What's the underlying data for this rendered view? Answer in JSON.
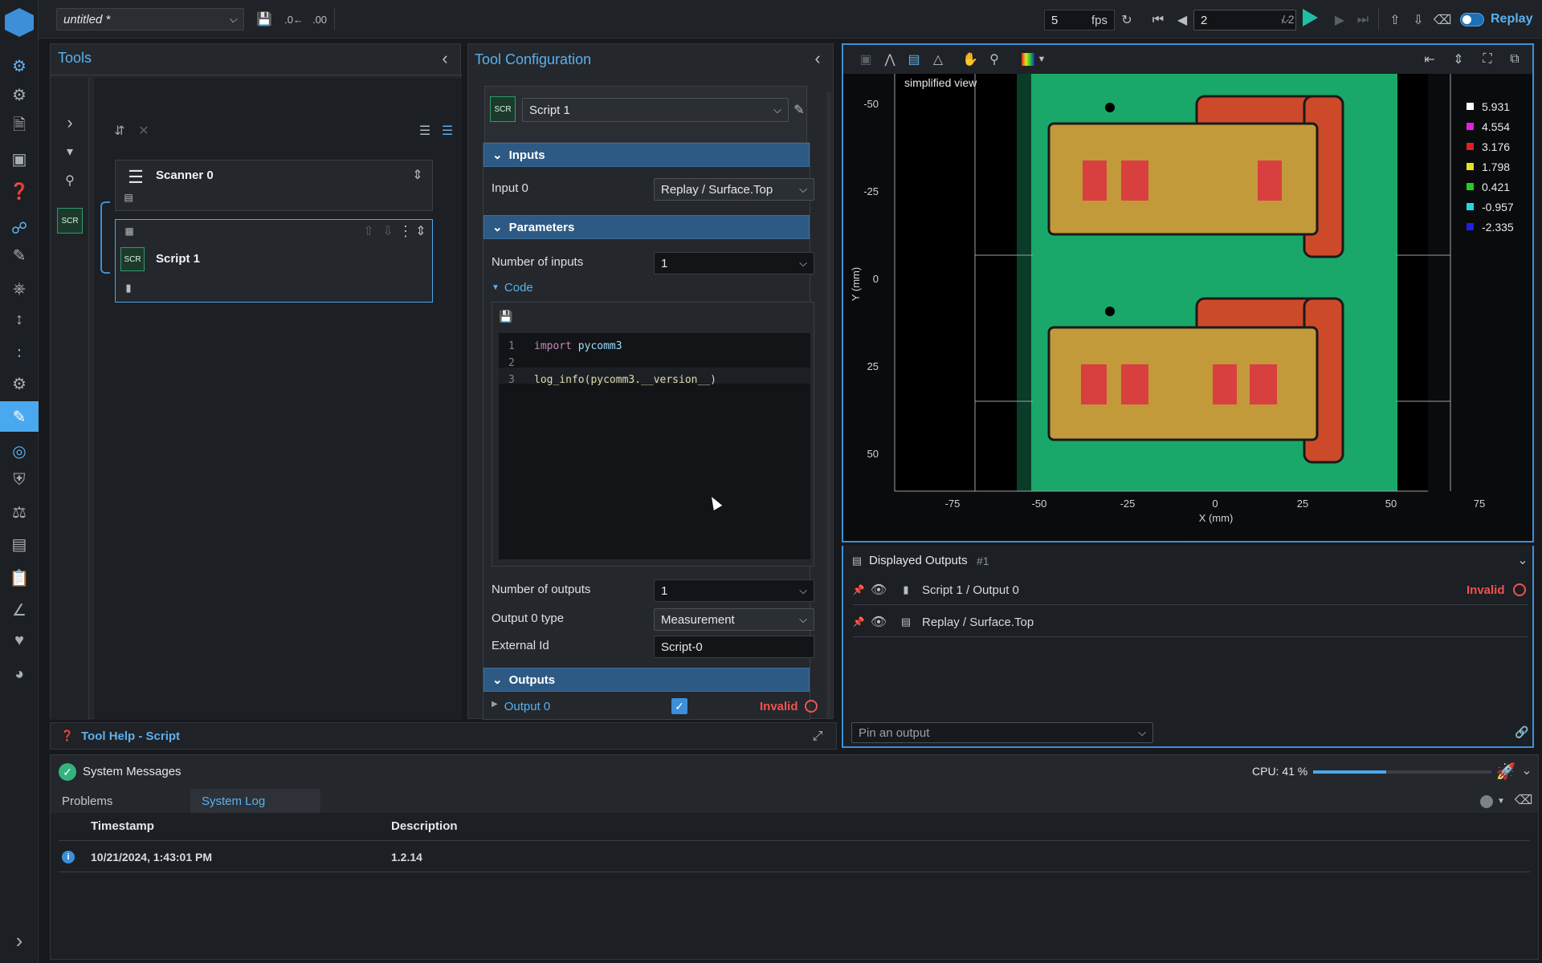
{
  "topbar": {
    "project_name": "untitled *",
    "fps_value": "5",
    "fps_unit": "fps",
    "frame_value": "2",
    "frame_total": "/ 2",
    "replay_label": "Replay"
  },
  "tools_panel": {
    "title": "Tools",
    "scanner_label": "Scanner 0",
    "script_label": "Script 1",
    "scr_badge": "SCR"
  },
  "config_panel": {
    "title": "Tool Configuration",
    "badge": "SCR",
    "tool_select": "Script 1",
    "inputs_header": "Inputs",
    "input0_label": "Input 0",
    "input0_value": "Replay / Surface.Top",
    "parameters_header": "Parameters",
    "num_inputs_label": "Number of inputs",
    "num_inputs_value": "1",
    "code_label": "Code",
    "code_lines": [
      {
        "num": "1",
        "kw": "import",
        "text": "pycomm3"
      },
      {
        "num": "2",
        "kw": "",
        "text": ""
      },
      {
        "num": "3",
        "kw": "",
        "text": "log_info(pycomm3.__version__)"
      }
    ],
    "num_outputs_label": "Number of outputs",
    "num_outputs_value": "1",
    "output_type_label": "Output 0 type",
    "output_type_value": "Measurement",
    "external_id_label": "External Id",
    "external_id_value": "Script-0",
    "outputs_header": "Outputs",
    "output0_label": "Output 0",
    "output0_status": "Invalid"
  },
  "viewer": {
    "overlay_text": "simplified view",
    "y_axis_label": "Y (mm)",
    "x_axis_label": "X (mm)",
    "y_ticks": [
      "-50",
      "-25",
      "0",
      "25",
      "50"
    ],
    "x_ticks": [
      "-75",
      "-50",
      "-25",
      "0",
      "25",
      "50",
      "75"
    ],
    "legend": [
      {
        "value": "5.931",
        "color": "#ffffff"
      },
      {
        "value": "4.554",
        "color": "#e020e0"
      },
      {
        "value": "3.176",
        "color": "#e02020"
      },
      {
        "value": "1.798",
        "color": "#e8e020"
      },
      {
        "value": "0.421",
        "color": "#20d020"
      },
      {
        "value": "-0.957",
        "color": "#20d8e0"
      },
      {
        "value": "-2.335",
        "color": "#2020e8"
      }
    ]
  },
  "displayed_outputs": {
    "title": "Displayed Outputs",
    "count": "#1",
    "rows": [
      {
        "label": "Script 1 / Output 0",
        "status": "Invalid"
      },
      {
        "label": "Replay / Surface.Top",
        "status": ""
      }
    ],
    "pin_placeholder": "Pin an output"
  },
  "tool_help": {
    "title": "Tool Help - Script"
  },
  "system_messages": {
    "title": "System Messages",
    "cpu_label": "CPU: 41 %",
    "cpu_fraction": 0.41,
    "tabs": [
      "Problems",
      "System Log"
    ],
    "columns": [
      "Timestamp",
      "Description"
    ],
    "rows": [
      {
        "timestamp": "10/21/2024, 1:43:01 PM",
        "description": "1.2.14"
      }
    ]
  },
  "colors": {
    "accent": "#5ab1ef",
    "invalid": "#ef5350",
    "play": "#1fbfa6"
  }
}
